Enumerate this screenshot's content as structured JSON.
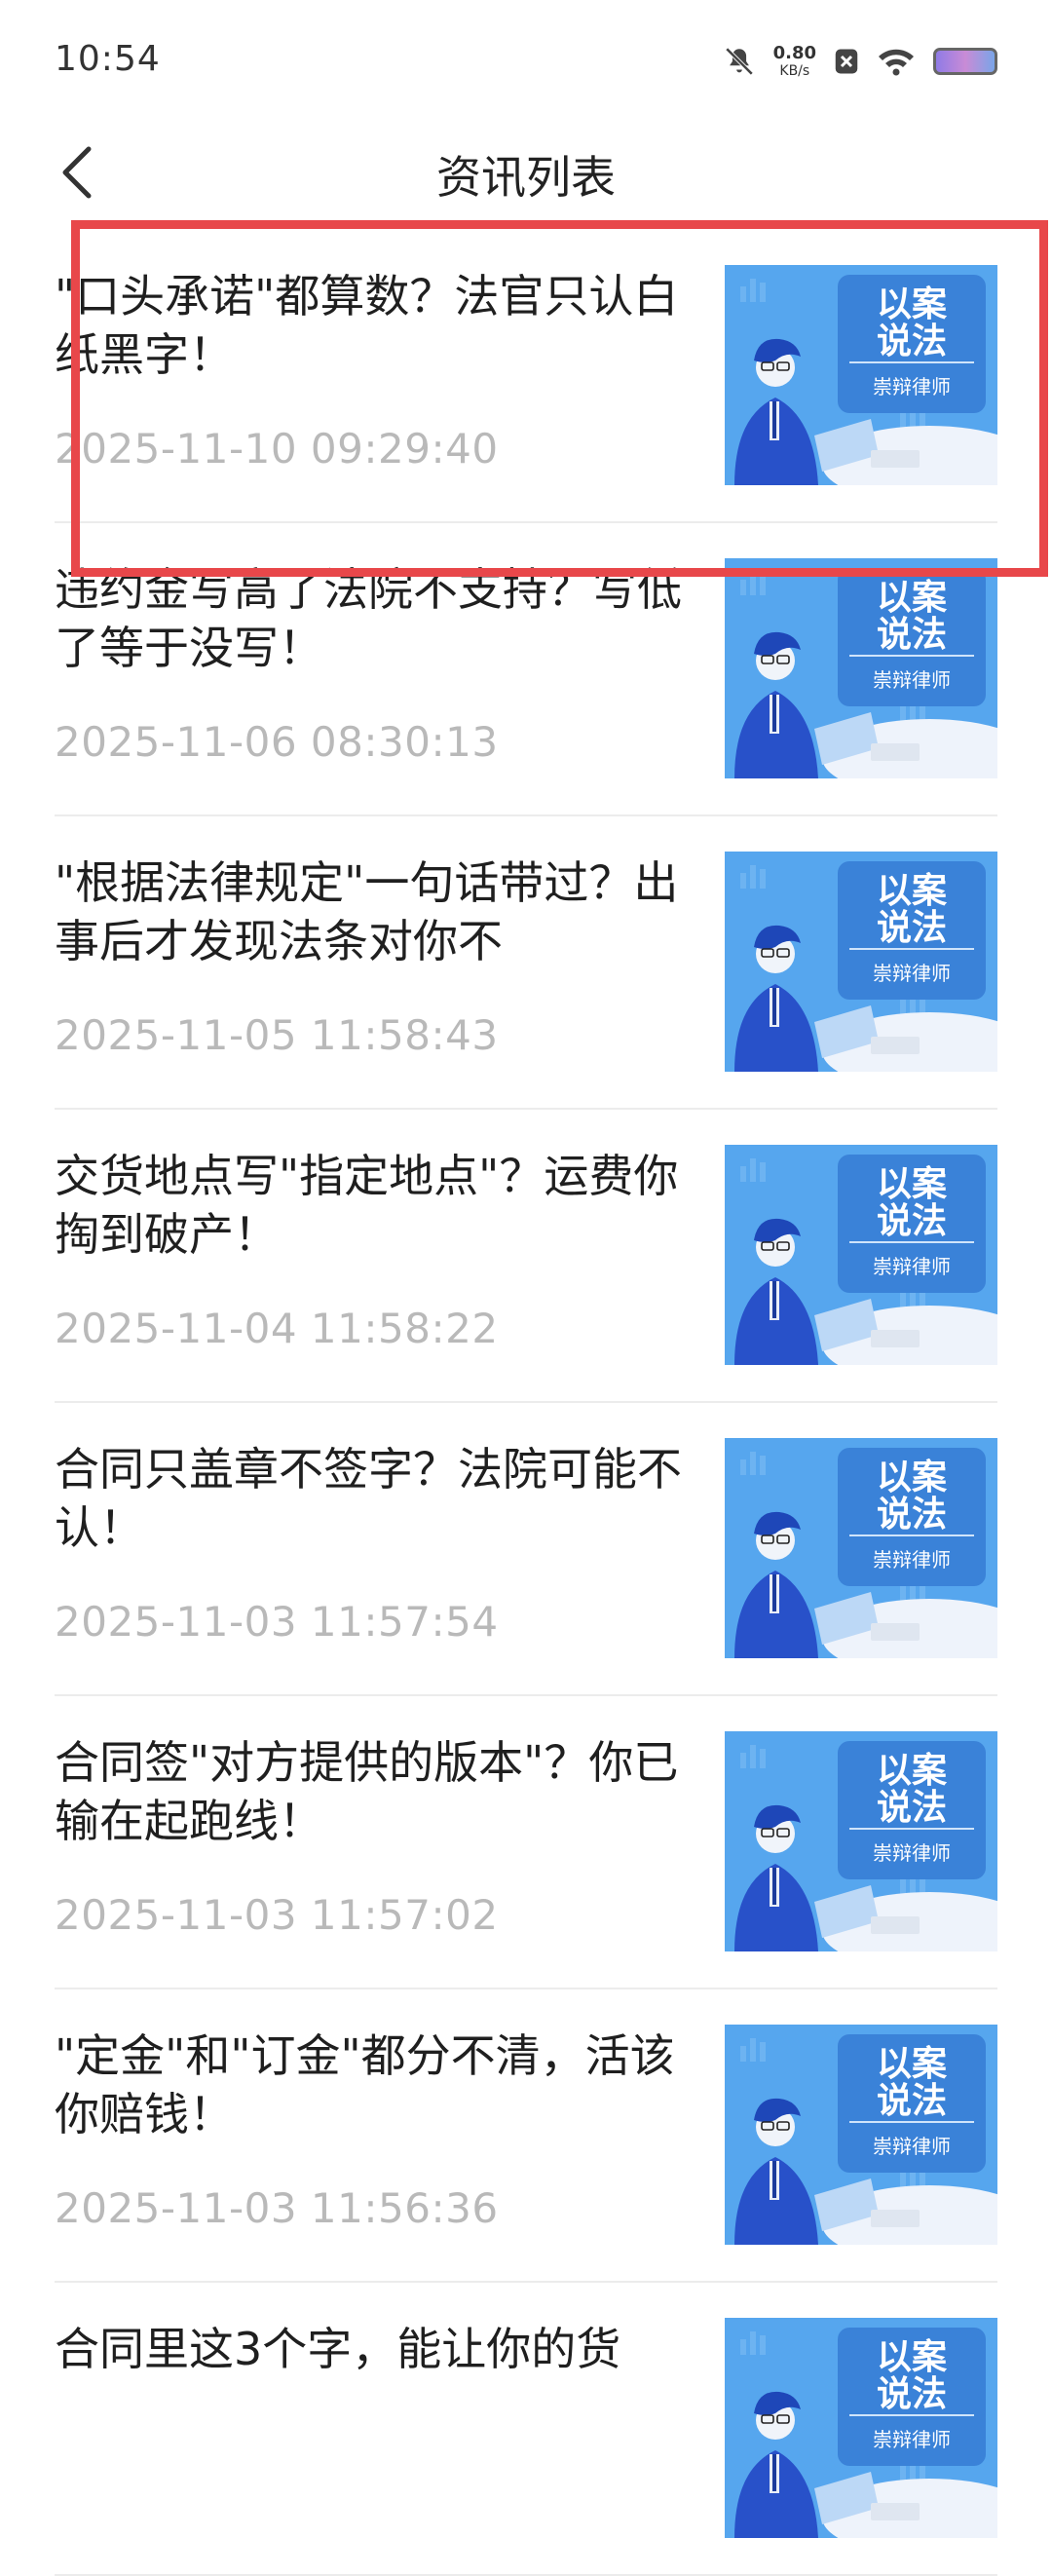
{
  "status_bar": {
    "time": "10:54",
    "net_speed_value": "0.80",
    "net_speed_unit": "KB/s",
    "icons": [
      "mute-icon",
      "sim-x-icon",
      "wifi-icon",
      "battery-icon"
    ]
  },
  "header": {
    "title": "资讯列表",
    "back_icon": "chevron-left-icon"
  },
  "thumbnail": {
    "line1": "以案",
    "line2": "说法",
    "caption": "崇辩律师",
    "bg_color": "#4fa0ec",
    "badge_color": "#3b7fd6"
  },
  "news": [
    {
      "title": "\"口头承诺\"都算数？法官只认白纸黑字！",
      "time": "2025-11-10 09:29:40"
    },
    {
      "title": "违约金写高了法院不支持？写低了等于没写！",
      "time": "2025-11-06 08:30:13"
    },
    {
      "title": "\"根据法律规定\"一句话带过？出事后才发现法条对你不",
      "time": "2025-11-05 11:58:43"
    },
    {
      "title": "交货地点写\"指定地点\"？运费你掏到破产！",
      "time": "2025-11-04 11:58:22"
    },
    {
      "title": "合同只盖章不签字？法院可能不认！",
      "time": "2025-11-03 11:57:54"
    },
    {
      "title": "合同签\"对方提供的版本\"？你已输在起跑线！",
      "time": "2025-11-03 11:57:02"
    },
    {
      "title": "\"定金\"和\"订金\"都分不清，活该你赔钱！",
      "time": "2025-11-03 11:56:36"
    },
    {
      "title": "合同里这3个字，能让你的货",
      "time": ""
    }
  ],
  "highlight_color": "#e8474a"
}
